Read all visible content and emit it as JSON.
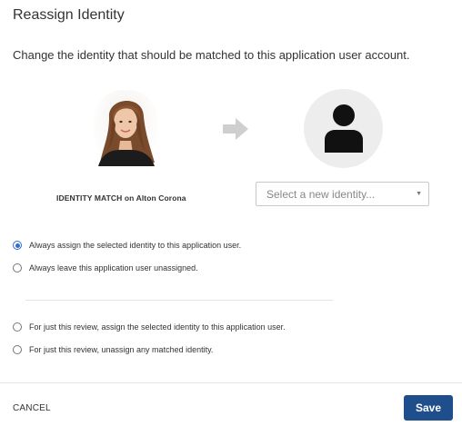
{
  "dialog": {
    "title": "Reassign Identity",
    "description": "Change the identity that should be matched to this application user account."
  },
  "match": {
    "label": "IDENTITY MATCH on Alton Corona",
    "photo_icon": "user-photo",
    "arrow_icon": "arrow-right-icon",
    "placeholder_avatar_icon": "user-silhouette-icon"
  },
  "identity_select": {
    "placeholder": "Select a new identity...",
    "caret": "▼"
  },
  "options": [
    {
      "label": "Always assign the selected identity to this application user.",
      "checked": true
    },
    {
      "label": "Always leave this application user unassigned.",
      "checked": false
    },
    {
      "label": "For just this review, assign the selected identity to this application user.",
      "checked": false
    },
    {
      "label": "For just this review, unassign any matched identity.",
      "checked": false
    }
  ],
  "footer": {
    "cancel_label": "CANCEL",
    "save_label": "Save"
  },
  "colors": {
    "save_button": "#1f4e8c",
    "radio_accent": "#2f6ed4",
    "avatar_bg": "#ededed",
    "arrow": "#cfcfcf"
  }
}
